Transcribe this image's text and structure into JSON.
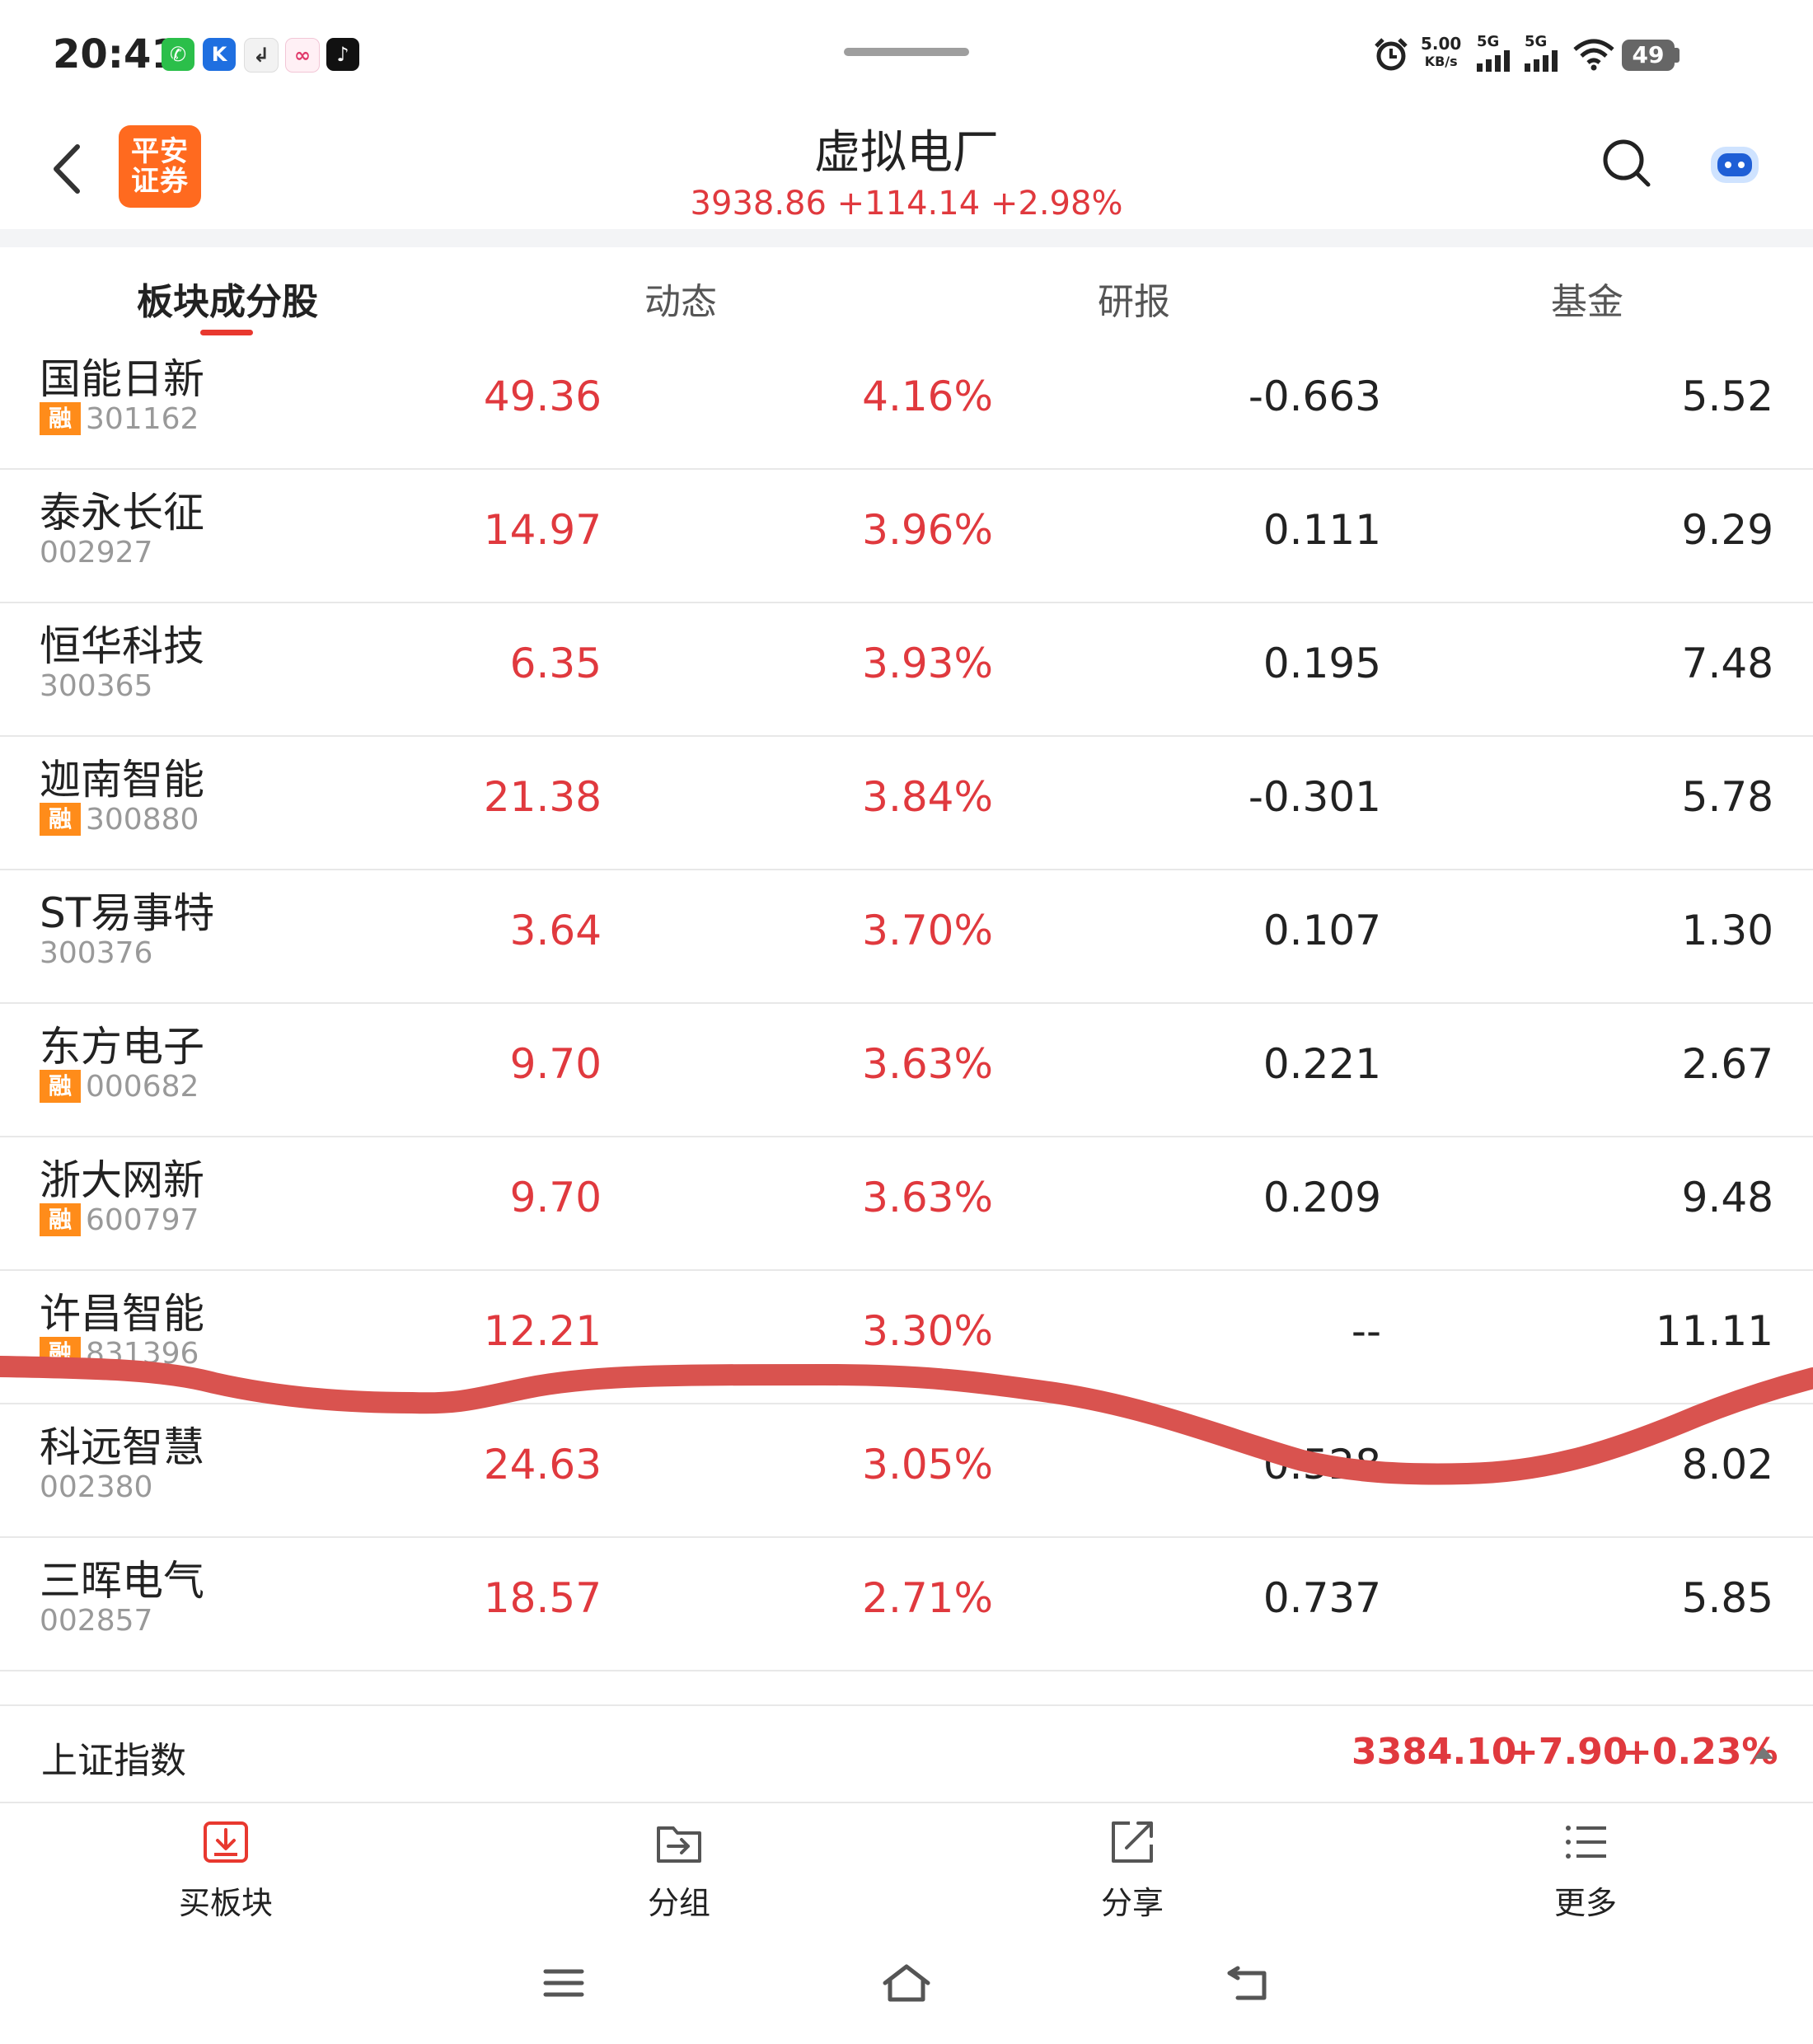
{
  "status_bar": {
    "time": "20:41",
    "net_speed_value": "5.00",
    "net_speed_unit": "KB/s",
    "signal1_label": "5G",
    "signal2_label": "5G",
    "battery": "49",
    "app_icons": [
      "wechat-icon",
      "k-app-icon",
      "small-app-icon",
      "music-app-icon",
      "tiktok-icon"
    ]
  },
  "header": {
    "logo_line1": "平安",
    "logo_line2": "证券",
    "title": "虚拟电厂",
    "index_quote": "3938.86 +114.14 +2.98%"
  },
  "tabs": [
    {
      "label": "板块成分股",
      "active": true
    },
    {
      "label": "动态",
      "active": false
    },
    {
      "label": "研报",
      "active": false
    },
    {
      "label": "基金",
      "active": false
    }
  ],
  "margin_tag": "融",
  "stocks": [
    {
      "name": "国能日新",
      "code": "301162",
      "margin": true,
      "price": "49.36",
      "change": "4.16%",
      "col3": "-0.663",
      "col4": "5.52"
    },
    {
      "name": "泰永长征",
      "code": "002927",
      "margin": false,
      "price": "14.97",
      "change": "3.96%",
      "col3": "0.111",
      "col4": "9.29"
    },
    {
      "name": "恒华科技",
      "code": "300365",
      "margin": false,
      "price": "6.35",
      "change": "3.93%",
      "col3": "0.195",
      "col4": "7.48"
    },
    {
      "name": "迦南智能",
      "code": "300880",
      "margin": true,
      "price": "21.38",
      "change": "3.84%",
      "col3": "-0.301",
      "col4": "5.78"
    },
    {
      "name": "ST易事特",
      "code": "300376",
      "margin": false,
      "price": "3.64",
      "change": "3.70%",
      "col3": "0.107",
      "col4": "1.30"
    },
    {
      "name": "东方电子",
      "code": "000682",
      "margin": true,
      "price": "9.70",
      "change": "3.63%",
      "col3": "0.221",
      "col4": "2.67"
    },
    {
      "name": "浙大网新",
      "code": "600797",
      "margin": true,
      "price": "9.70",
      "change": "3.63%",
      "col3": "0.209",
      "col4": "9.48"
    },
    {
      "name": "许昌智能",
      "code": "831396",
      "margin": true,
      "price": "12.21",
      "change": "3.30%",
      "col3": "--",
      "col4": "11.11"
    },
    {
      "name": "科远智慧",
      "code": "002380",
      "margin": false,
      "price": "24.63",
      "change": "3.05%",
      "col3": "0.528",
      "col4": "8.02"
    },
    {
      "name": "三晖电气",
      "code": "002857",
      "margin": false,
      "price": "18.57",
      "change": "2.71%",
      "col3": "0.737",
      "col4": "5.85"
    }
  ],
  "ticker": {
    "name": "上证指数",
    "price": "3384.10",
    "change": "+7.90",
    "pct": "+0.23%"
  },
  "actions": [
    {
      "label": "买板块",
      "icon": "download-tray-icon",
      "accent": "#e8382f"
    },
    {
      "label": "分组",
      "icon": "folder-arrow-icon",
      "accent": "#555555"
    },
    {
      "label": "分享",
      "icon": "share-icon",
      "accent": "#555555"
    },
    {
      "label": "更多",
      "icon": "list-icon",
      "accent": "#555555"
    }
  ],
  "colors": {
    "up_red": "#e0393e",
    "brand_orange": "#ff6a1f",
    "margin_tag": "#ff8c1a",
    "annotation_stroke": "#d9534f"
  }
}
